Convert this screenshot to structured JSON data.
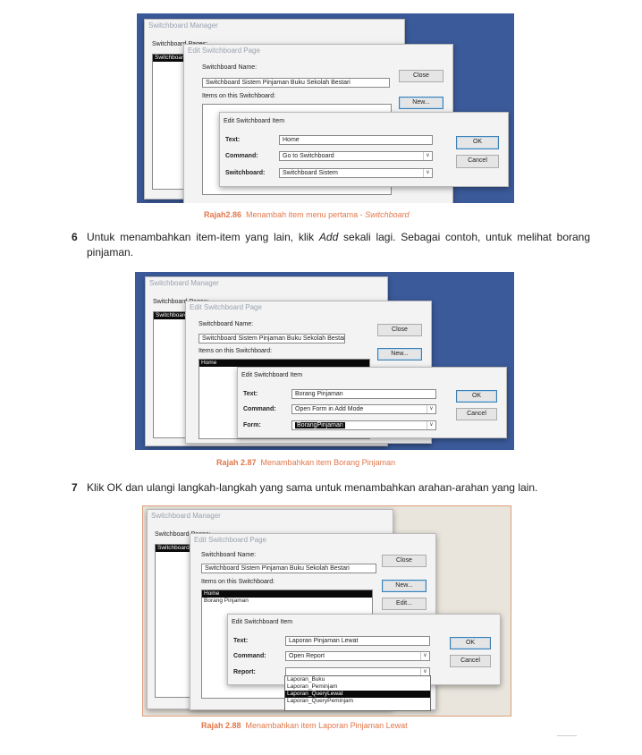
{
  "figure1": {
    "mgr_title": "Switchboard Manager",
    "mgr_label": "Switchboard Pages:",
    "mgr_list_item": "Switchboard S",
    "page_title": "Edit Switchboard Page",
    "name_label": "Switchboard Name:",
    "name_value": "Switchboard Sistem Pinjaman Buku Sekolah Bestari",
    "items_label": "Items on this Switchboard:",
    "close_btn": "Close",
    "new_btn": "New...",
    "item_title": "Edit Switchboard Item",
    "text_label": "Text:",
    "text_value": "Home",
    "command_label": "Command:",
    "command_value": "Go to Switchboard",
    "third_label": "Switchboard:",
    "third_value": "Switchboard Sistem",
    "ok_btn": "OK",
    "cancel_btn": "Cancel",
    "caption_num": "Rajah2.86",
    "caption_text": "Menambah item menu pertama - ",
    "caption_em": "Switchboard"
  },
  "step6": {
    "num": "6",
    "text_a": "Untuk menambahkan item-item yang lain, klik ",
    "text_em": "Add",
    "text_b": " sekali lagi. Sebagai contoh, untuk melihat borang pinjaman."
  },
  "figure2": {
    "mgr_title": "Switchboard Manager",
    "mgr_label": "Switchboard Pages:",
    "mgr_list_item": "Switchboard S",
    "page_title": "Edit Switchboard Page",
    "name_label": "Switchboard Name:",
    "name_value": "Switchboard Sistem Pinjaman Buku Sekolah Bestari",
    "items_label": "Items on this Switchboard:",
    "items": [
      "Home"
    ],
    "close_btn": "Close",
    "new_btn": "New...",
    "item_title": "Edit Switchboard Item",
    "text_label": "Text:",
    "text_value": "Borang Pinjaman",
    "command_label": "Command:",
    "command_value": "Open Form in Add Mode",
    "third_label": "Form:",
    "third_value": "BorangPinjaman",
    "ok_btn": "OK",
    "cancel_btn": "Cancel",
    "caption_num": "Rajah 2.87",
    "caption_text": "Menambahkan item Borang Pinjaman"
  },
  "step7": {
    "num": "7",
    "text": "Klik OK dan ulangi langkah-langkah yang sama untuk menambahkan arahan-arahan yang lain."
  },
  "figure3": {
    "mgr_title": "Switchboard Manager",
    "mgr_label": "Switchboard Pages:",
    "mgr_list_item": "Switchboard S",
    "page_title": "Edit Switchboard Page",
    "name_label": "Switchboard Name:",
    "name_value": "Switchboard Sistem Pinjaman Buku Sekolah Bestari",
    "items_label": "Items on this Switchboard:",
    "items": [
      "Home",
      "Borang Pinjaman"
    ],
    "close_btn": "Close",
    "new_btn": "New...",
    "edit_btn": "Edit...",
    "item_title": "Edit Switchboard Item",
    "text_label": "Text:",
    "text_value": "Laporan Pinjaman Lewat",
    "command_label": "Command:",
    "command_value": "Open Report",
    "third_label": "Report:",
    "third_value": "",
    "report_options": [
      "Laporan_Buku",
      "Laporan_Peminjam",
      "Laporan_QueryLewat",
      "Laporan_QueryPeminjam"
    ],
    "ok_btn": "OK",
    "cancel_btn": "Cancel",
    "caption_num": "Rajah 2.88",
    "caption_text": "Menambahkan item Laporan Pinjaman Lewat"
  }
}
